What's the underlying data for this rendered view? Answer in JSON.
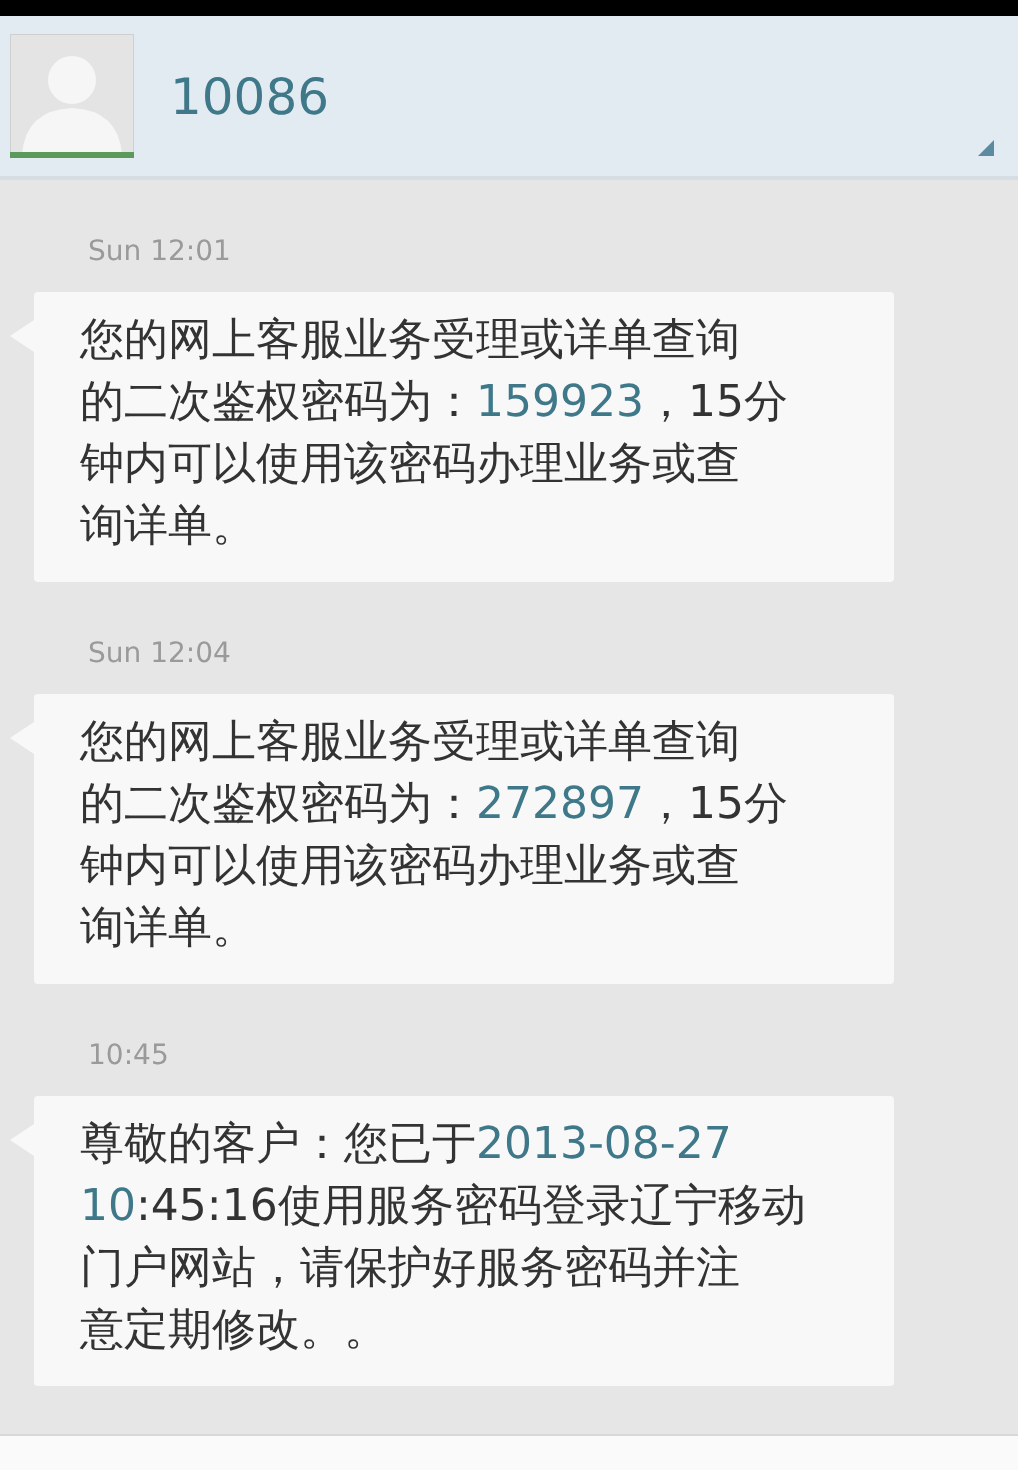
{
  "header": {
    "contact": "10086"
  },
  "messages": [
    {
      "time": "Sun 12:01",
      "lines": [
        [
          {
            "kind": "plain",
            "text": "您的网上客服业务受理或详单查询"
          }
        ],
        [
          {
            "kind": "plain",
            "text": "的二次鉴权密码为："
          },
          {
            "kind": "link",
            "text": "159923"
          },
          {
            "kind": "plain",
            "text": "，15分"
          }
        ],
        [
          {
            "kind": "plain",
            "text": "钟内可以使用该密码办理业务或查"
          }
        ],
        [
          {
            "kind": "plain",
            "text": "询详单。"
          }
        ]
      ]
    },
    {
      "time": "Sun 12:04",
      "lines": [
        [
          {
            "kind": "plain",
            "text": "您的网上客服业务受理或详单查询"
          }
        ],
        [
          {
            "kind": "plain",
            "text": "的二次鉴权密码为："
          },
          {
            "kind": "link",
            "text": "272897"
          },
          {
            "kind": "plain",
            "text": "，15分"
          }
        ],
        [
          {
            "kind": "plain",
            "text": "钟内可以使用该密码办理业务或查"
          }
        ],
        [
          {
            "kind": "plain",
            "text": "询详单。"
          }
        ]
      ]
    },
    {
      "time": "10:45",
      "lines": [
        [
          {
            "kind": "plain",
            "text": "尊敬的客户：您已于"
          },
          {
            "kind": "link",
            "text": "2013-08-27"
          }
        ],
        [
          {
            "kind": "link",
            "text": "10"
          },
          {
            "kind": "plain",
            "text": ":45:16使用服务密码登录辽宁移动"
          }
        ],
        [
          {
            "kind": "plain",
            "text": "门户网站，请保护好服务密码并注"
          }
        ],
        [
          {
            "kind": "plain",
            "text": "意定期修改。。"
          }
        ]
      ]
    }
  ]
}
